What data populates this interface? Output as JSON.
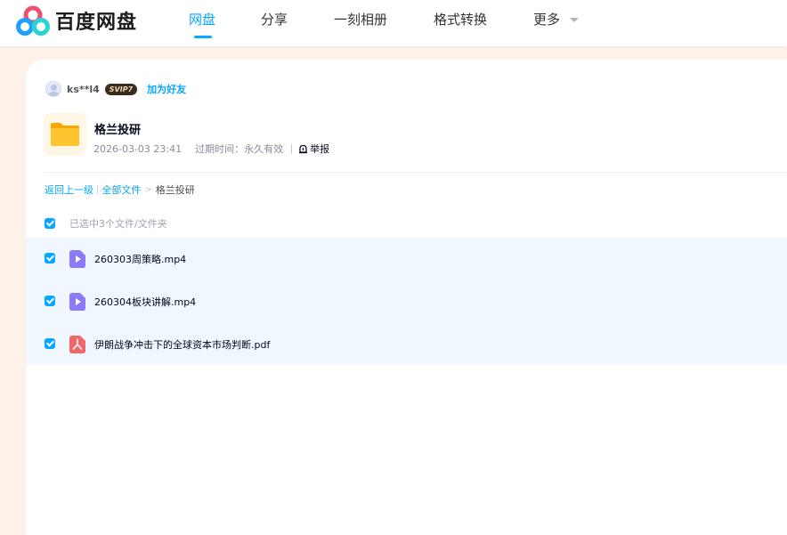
{
  "header": {
    "logo_text": "百度网盘",
    "nav": [
      {
        "label": "网盘",
        "active": true
      },
      {
        "label": "分享",
        "active": false
      },
      {
        "label": "一刻相册",
        "active": false
      },
      {
        "label": "格式转换",
        "active": false
      },
      {
        "label": "更多",
        "active": false
      }
    ]
  },
  "share": {
    "owner_name": "ks**l4",
    "vip_badge": "SVIP7",
    "add_friend": "加为好友",
    "title": "格兰投研",
    "date": "2026-03-03 23:41",
    "expire_label": "过期时间：永久有效",
    "report_label": "举报"
  },
  "breadcrumb": {
    "back": "返回上一级",
    "sep": "|",
    "all_files": "全部文件",
    "arrow": ">",
    "current": "格兰投研"
  },
  "selection": {
    "summary": "已选中3个文件/文件夹"
  },
  "files": [
    {
      "name": "260303周策略.mp4",
      "type": "video",
      "checked": true
    },
    {
      "name": "260304板块讲解.mp4",
      "type": "video",
      "checked": true
    },
    {
      "name": "伊朗战争冲击下的全球资本市场判断.pdf",
      "type": "pdf",
      "checked": true
    }
  ],
  "colors": {
    "accent": "#06a7ff",
    "video_icon": "#8b7bf7",
    "pdf_icon": "#f06868",
    "folder": "#ffc531"
  },
  "icons": {
    "logo": "baidu-netdisk-logo-icon",
    "folder": "folder-icon",
    "video": "video-file-icon",
    "pdf": "pdf-file-icon",
    "report": "report-icon",
    "more": "chevron-down-icon"
  }
}
